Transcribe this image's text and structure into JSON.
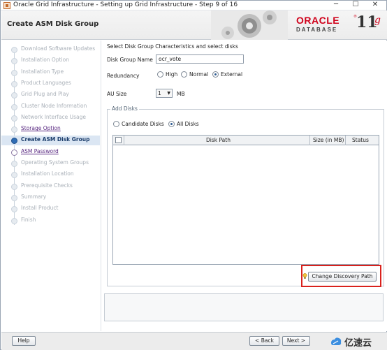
{
  "window": {
    "title": "Oracle Grid Infrastructure - Setting up Grid Infrastructure - Step 9 of 16",
    "minimize": "─",
    "maximize": "☐",
    "close": "✕"
  },
  "header": {
    "title": "Create ASM Disk Group",
    "brand": "ORACLE",
    "reg_mark": "®",
    "product": "DATABASE",
    "version": "11",
    "version_suffix": "g"
  },
  "steps": [
    {
      "label": "Download Software Updates",
      "state": "disabled"
    },
    {
      "label": "Installation Option",
      "state": "disabled"
    },
    {
      "label": "Installation Type",
      "state": "disabled"
    },
    {
      "label": "Product Languages",
      "state": "disabled"
    },
    {
      "label": "Grid Plug and Play",
      "state": "disabled"
    },
    {
      "label": "Cluster Node Information",
      "state": "disabled"
    },
    {
      "label": "Network Interface Usage",
      "state": "disabled"
    },
    {
      "label": "Storage Option",
      "state": "prev"
    },
    {
      "label": "Create ASM Disk Group",
      "state": "current"
    },
    {
      "label": "ASM Password",
      "state": "link"
    },
    {
      "label": "Operating System Groups",
      "state": "disabled"
    },
    {
      "label": "Installation Location",
      "state": "disabled"
    },
    {
      "label": "Prerequisite Checks",
      "state": "disabled"
    },
    {
      "label": "Summary",
      "state": "disabled"
    },
    {
      "label": "Install Product",
      "state": "disabled"
    },
    {
      "label": "Finish",
      "state": "disabled"
    }
  ],
  "form": {
    "intro": "Select Disk Group Characteristics and select disks",
    "disk_group_name_label": "Disk Group Name",
    "disk_group_name_value": "ocr_vote",
    "redundancy_label": "Redundancy",
    "redundancy_options": [
      {
        "label": "High",
        "checked": false
      },
      {
        "label": "Normal",
        "checked": false
      },
      {
        "label": "External",
        "checked": true
      }
    ],
    "au_size_label": "AU Size",
    "au_size_value": "1",
    "au_size_unit": "MB"
  },
  "add_disks": {
    "legend": "Add Disks",
    "filter_options": [
      {
        "label": "Candidate Disks",
        "checked": false
      },
      {
        "label": "All Disks",
        "checked": true
      }
    ],
    "columns": [
      "Disk Path",
      "Size (in MB)",
      "Status"
    ],
    "rows": [],
    "change_discovery_path": "Change Discovery Path"
  },
  "footer": {
    "help": "Help",
    "back": "< Back",
    "next": "Next >"
  },
  "watermark": {
    "text": "亿速云"
  },
  "colors": {
    "accent": "#d9211c",
    "oracle_red": "#d0021b",
    "current_step_bg": "#dbe6f3",
    "link_purple": "#5a2a82"
  }
}
